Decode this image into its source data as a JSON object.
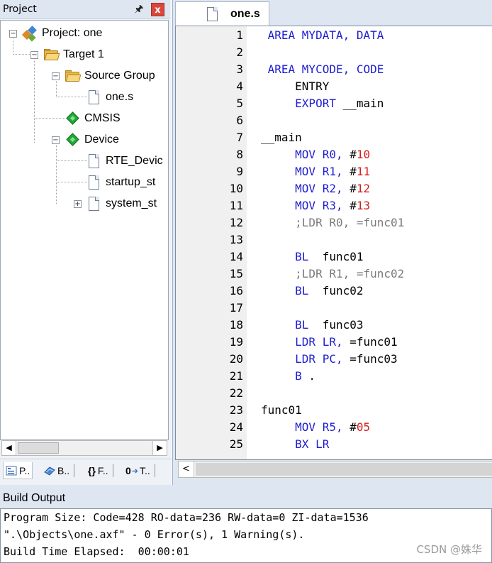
{
  "project_panel": {
    "title": "Project",
    "pin_icon": "pin-icon",
    "close_label": "x",
    "tree": {
      "project": "Project: one",
      "target": "Target 1",
      "source_group": "Source Group",
      "file": "one.s",
      "cmsis": "CMSIS",
      "device": "Device",
      "rte_device": "RTE_Devic",
      "startup": "startup_st",
      "system": "system_st"
    },
    "tabs": [
      {
        "label": "P..",
        "icon": "project-tab-icon"
      },
      {
        "label": "B..",
        "icon": "books-tab-icon"
      },
      {
        "label": "F..",
        "icon": "functions-tab-icon",
        "glyph": "{}"
      },
      {
        "label": "T..",
        "icon": "templates-tab-icon",
        "glyph": "0"
      }
    ]
  },
  "editor": {
    "tab_label": "one.s",
    "lines": [
      {
        "n": "1",
        "parts": [
          {
            "t": " AREA MYDATA, DATA",
            "c": "kw"
          }
        ]
      },
      {
        "n": "2",
        "parts": []
      },
      {
        "n": "3",
        "parts": [
          {
            "t": " AREA MYCODE, CODE",
            "c": "kw"
          }
        ]
      },
      {
        "n": "4",
        "parts": [
          {
            "t": "     ENTRY",
            "c": ""
          }
        ]
      },
      {
        "n": "5",
        "parts": [
          {
            "t": "     EXPORT",
            "c": "kw"
          },
          {
            "t": " __main",
            "c": ""
          }
        ]
      },
      {
        "n": "6",
        "parts": []
      },
      {
        "n": "7",
        "parts": [
          {
            "t": "__main",
            "c": ""
          }
        ]
      },
      {
        "n": "8",
        "parts": [
          {
            "t": "     MOV R0,",
            "c": "kw"
          },
          {
            "t": " #",
            "c": ""
          },
          {
            "t": "10",
            "c": "num"
          }
        ]
      },
      {
        "n": "9",
        "parts": [
          {
            "t": "     MOV R1,",
            "c": "kw"
          },
          {
            "t": " #",
            "c": ""
          },
          {
            "t": "11",
            "c": "num"
          }
        ]
      },
      {
        "n": "10",
        "parts": [
          {
            "t": "     MOV R2,",
            "c": "kw"
          },
          {
            "t": " #",
            "c": ""
          },
          {
            "t": "12",
            "c": "num"
          }
        ]
      },
      {
        "n": "11",
        "parts": [
          {
            "t": "     MOV R3,",
            "c": "kw"
          },
          {
            "t": " #",
            "c": ""
          },
          {
            "t": "13",
            "c": "num"
          }
        ]
      },
      {
        "n": "12",
        "parts": [
          {
            "t": "     ;LDR R0, =func01",
            "c": "cmt"
          }
        ]
      },
      {
        "n": "13",
        "parts": []
      },
      {
        "n": "14",
        "parts": [
          {
            "t": "     BL",
            "c": "kw"
          },
          {
            "t": "  func01",
            "c": ""
          }
        ]
      },
      {
        "n": "15",
        "parts": [
          {
            "t": "     ;LDR R1, =func02",
            "c": "cmt"
          }
        ]
      },
      {
        "n": "16",
        "parts": [
          {
            "t": "     BL",
            "c": "kw"
          },
          {
            "t": "  func02",
            "c": ""
          }
        ]
      },
      {
        "n": "17",
        "parts": []
      },
      {
        "n": "18",
        "parts": [
          {
            "t": "     BL",
            "c": "kw"
          },
          {
            "t": "  func03",
            "c": ""
          }
        ]
      },
      {
        "n": "19",
        "parts": [
          {
            "t": "     LDR LR,",
            "c": "kw"
          },
          {
            "t": " =func01",
            "c": ""
          }
        ]
      },
      {
        "n": "20",
        "parts": [
          {
            "t": "     LDR PC,",
            "c": "kw"
          },
          {
            "t": " =func03",
            "c": ""
          }
        ]
      },
      {
        "n": "21",
        "parts": [
          {
            "t": "     B",
            "c": "kw"
          },
          {
            "t": " .",
            "c": ""
          }
        ]
      },
      {
        "n": "22",
        "parts": []
      },
      {
        "n": "23",
        "parts": [
          {
            "t": "func01",
            "c": ""
          }
        ]
      },
      {
        "n": "24",
        "parts": [
          {
            "t": "     MOV R5,",
            "c": "kw"
          },
          {
            "t": " #",
            "c": ""
          },
          {
            "t": "05",
            "c": "num"
          }
        ]
      },
      {
        "n": "25",
        "parts": [
          {
            "t": "     BX LR",
            "c": "kw"
          }
        ]
      }
    ],
    "scroll_left": "<"
  },
  "build_output": {
    "title": "Build Output",
    "lines": [
      "Program Size: Code=428 RO-data=236 RW-data=0 ZI-data=1536",
      "\".\\Objects\\one.axf\" - 0 Error(s), 1 Warning(s).",
      "Build Time Elapsed:  00:00:01"
    ],
    "watermark": "CSDN @姝华"
  },
  "colors": {
    "keyword": "#1f1fd2",
    "number": "#d61d1d",
    "comment": "#7a7a7a",
    "panel_bg": "#dde6f1"
  }
}
